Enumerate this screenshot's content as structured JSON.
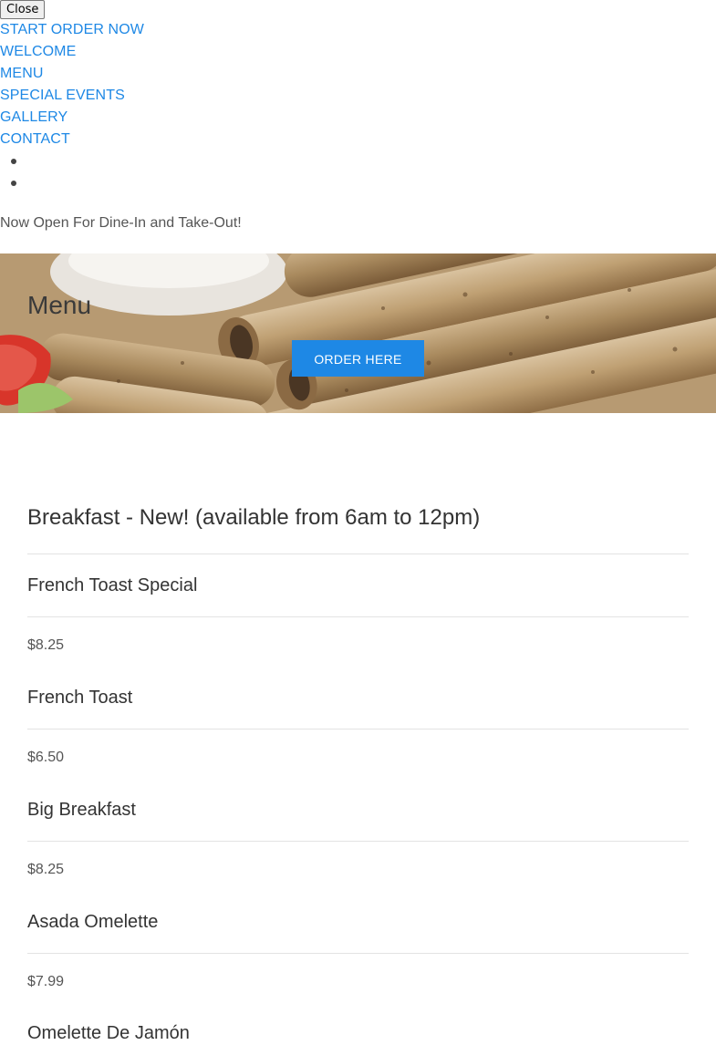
{
  "overlay": {
    "close_label": "Close"
  },
  "nav": {
    "links": [
      "START ORDER NOW",
      "WELCOME",
      "MENU",
      "SPECIAL EVENTS",
      "GALLERY",
      "CONTACT"
    ],
    "link_color": "#1e88e5"
  },
  "tagline": "Now Open For Dine-In and Take-Out!",
  "hero": {
    "title": "Menu",
    "order_button": "ORDER HERE",
    "accent": "#1e88e5"
  },
  "menu": {
    "section_title": "Breakfast - New! (available from 6am to 12pm)",
    "items": [
      {
        "name": "French Toast Special",
        "price": "$8.25"
      },
      {
        "name": "French Toast",
        "price": "$6.50"
      },
      {
        "name": "Big Breakfast",
        "price": "$8.25"
      },
      {
        "name": "Asada Omelette",
        "price": "$7.99"
      },
      {
        "name": "Omelette De Jamón",
        "price": ""
      }
    ]
  }
}
